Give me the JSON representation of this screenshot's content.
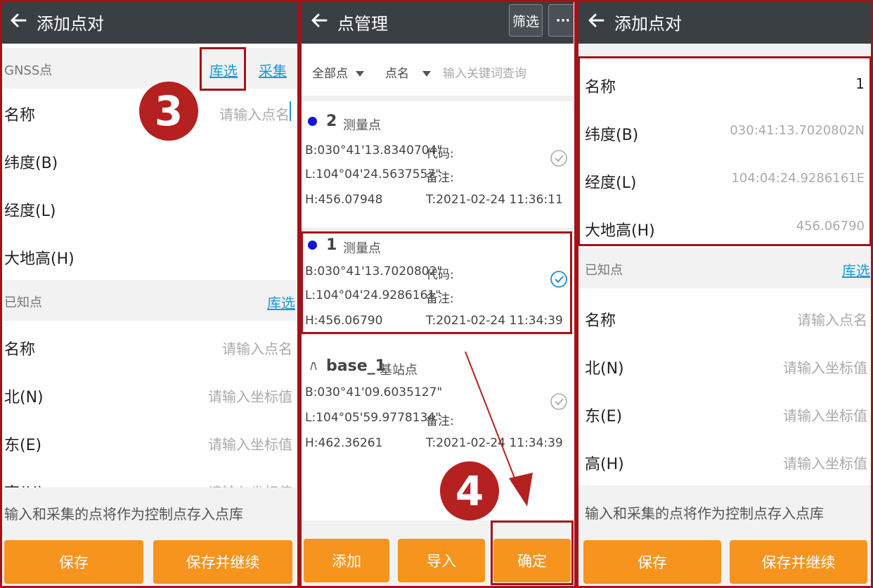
{
  "left": {
    "title": "添加点对",
    "gnss_label": "GNSS点",
    "lib_select": "库选",
    "collect": "采集",
    "gnss_fields": [
      {
        "label": "名称",
        "value": "请输入点名"
      },
      {
        "label": "纬度(B)",
        "value": ""
      },
      {
        "label": "经度(L)",
        "value": ""
      },
      {
        "label": "大地高(H)",
        "value": ""
      }
    ],
    "known_label": "已知点",
    "known_lib_select": "库选",
    "known_fields": [
      {
        "label": "名称",
        "value": "请输入点名"
      },
      {
        "label": "北(N)",
        "value": "请输入坐标值"
      },
      {
        "label": "东(E)",
        "value": "请输入坐标值"
      },
      {
        "label": "高(H)",
        "value": "请输入坐标值"
      }
    ],
    "note": "输入和采集的点将作为控制点存入点库",
    "save": "保存",
    "save_continue": "保存并继续",
    "step_badge": "3"
  },
  "middle": {
    "title": "点管理",
    "filter_btn": "筛选",
    "more": "···",
    "filter_all": "全部点",
    "filter_name": "点名",
    "search_placeholder": "输入关键词查询",
    "points": [
      {
        "name": "2",
        "type": "测量点",
        "b": "B:030°41'13.8340704\"",
        "l": "L:104°04'24.5637557\"",
        "h": "H:456.07948",
        "code": "代码:",
        "remark": "备注:",
        "time": "T:2021-02-24 11:36:11"
      },
      {
        "name": "1",
        "type": "测量点",
        "b": "B:030°41'13.7020802\"",
        "l": "L:104°04'24.9286161\"",
        "h": "H:456.06790",
        "code": "代码:",
        "remark": "备注:",
        "time": "T:2021-02-24 11:34:39"
      },
      {
        "name": "base_1",
        "type": "基站点",
        "b": "B:030°41'09.6035127\"",
        "l": "L:104°05'59.9778134\"",
        "h": "H:462.36261",
        "code": "",
        "remark": "备注:",
        "time": "T:2021-02-24 11:34:39"
      }
    ],
    "add": "添加",
    "import": "导入",
    "confirm": "确定",
    "step_badge": "4"
  },
  "right": {
    "title": "添加点对",
    "gnss_fields": [
      {
        "label": "名称",
        "value": "1"
      },
      {
        "label": "纬度(B)",
        "value": "030:41:13.7020802N"
      },
      {
        "label": "经度(L)",
        "value": "104:04:24.9286161E"
      },
      {
        "label": "大地高(H)",
        "value": "456.06790"
      }
    ],
    "known_label": "已知点",
    "known_lib_select": "库选",
    "known_fields": [
      {
        "label": "名称",
        "value": "请输入点名"
      },
      {
        "label": "北(N)",
        "value": "请输入坐标值"
      },
      {
        "label": "东(E)",
        "value": "请输入坐标值"
      },
      {
        "label": "高(H)",
        "value": "请输入坐标值"
      }
    ],
    "note": "输入和采集的点将作为控制点存入点库",
    "save": "保存",
    "save_continue": "保存并继续"
  },
  "colors": {
    "accent": "#f6941e",
    "appbar": "#3a3f44",
    "link": "#1a9ad6",
    "frame": "#a31218",
    "badge": "#b52020"
  }
}
